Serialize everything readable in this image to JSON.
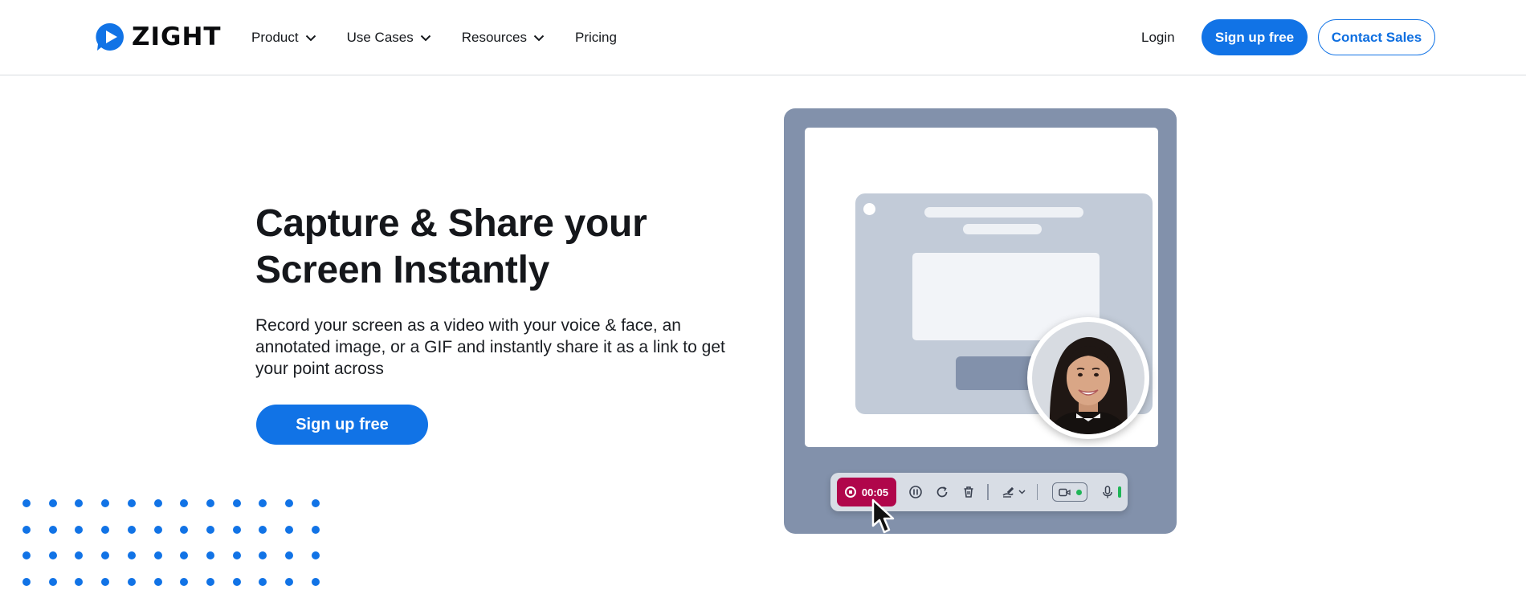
{
  "header": {
    "brand": "ZIGHT",
    "nav": [
      {
        "label": "Product",
        "has_dropdown": true
      },
      {
        "label": "Use Cases",
        "has_dropdown": true
      },
      {
        "label": "Resources",
        "has_dropdown": true
      },
      {
        "label": "Pricing",
        "has_dropdown": false
      }
    ],
    "login_label": "Login",
    "signup_label": "Sign up free",
    "contact_label": "Contact Sales"
  },
  "hero": {
    "title_line1": "Capture & Share your",
    "title_line2": "Screen Instantly",
    "description": "Record your screen as a video with your voice & face, an annotated image, or a GIF and instantly share it as a link to get your point across",
    "cta_label": "Sign up free"
  },
  "illustration": {
    "recording_time": "00:05",
    "toolbar_icons": [
      "stop-icon",
      "pause-icon",
      "restart-icon",
      "trash-icon",
      "draw-icon",
      "chevron-down-icon",
      "camera-icon",
      "microphone-icon"
    ]
  },
  "colors": {
    "brand_blue": "#1173e6",
    "record_red": "#b0064b",
    "illustration_gray": "#8291ab"
  }
}
